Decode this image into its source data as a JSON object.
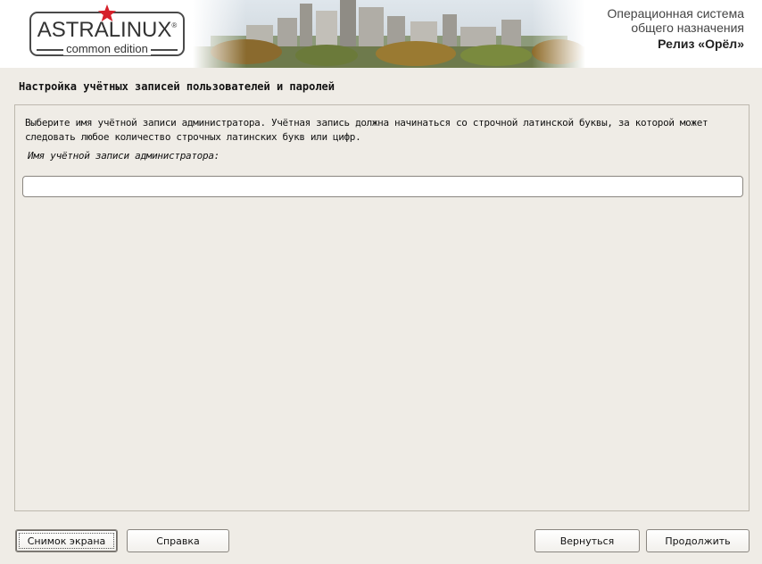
{
  "header": {
    "logo_title": "ASTRALINUX",
    "logo_registered": "®",
    "logo_subtitle": "common edition",
    "os_line1": "Операционная система",
    "os_line2": "общего назначения",
    "release": "Релиз «Орёл»"
  },
  "page": {
    "title": "Настройка учётных записей пользователей и паролей",
    "description": "Выберите имя учётной записи администратора. Учётная запись должна начинаться со строчной латинской буквы, за которой может следовать любое количество строчных латинских букв или цифр.",
    "field_label": "Имя учётной записи администратора:",
    "field_value": ""
  },
  "buttons": {
    "screenshot": "Снимок экрана",
    "help": "Справка",
    "back": "Вернуться",
    "continue": "Продолжить"
  },
  "colors": {
    "background": "#efece6",
    "star": "#d6202a",
    "border": "#bdb8ae"
  }
}
